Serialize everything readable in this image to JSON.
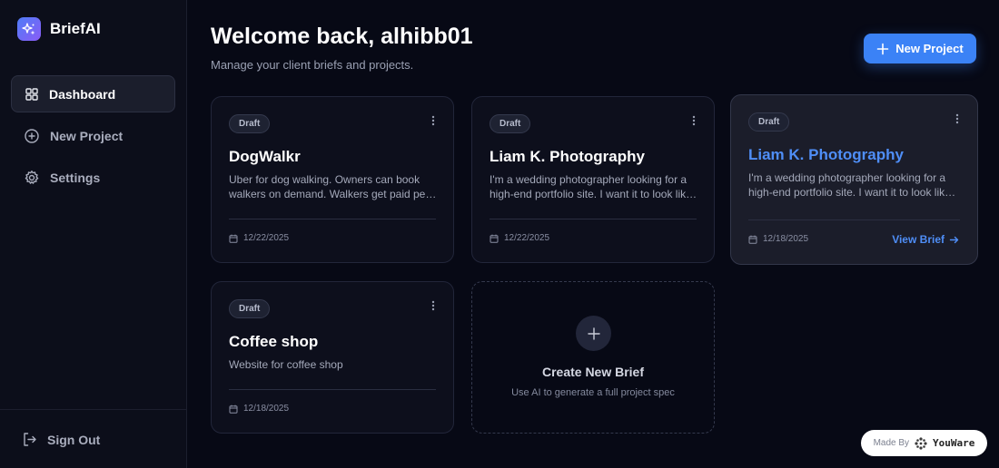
{
  "brand": {
    "name": "BriefAI"
  },
  "sidebar": {
    "items": [
      {
        "label": "Dashboard",
        "icon": "grid-icon",
        "active": true
      },
      {
        "label": "New Project",
        "icon": "plus-circle-icon",
        "active": false
      },
      {
        "label": "Settings",
        "icon": "gear-icon",
        "active": false
      }
    ],
    "sign_out": "Sign Out"
  },
  "header": {
    "title": "Welcome back, alhibb01",
    "subtitle": "Manage your client briefs and projects.",
    "new_project_label": "New Project"
  },
  "projects": [
    {
      "status": "Draft",
      "title": "DogWalkr",
      "description": "Uber for dog walking. Owners can book walkers on demand. Walkers get paid per walk.",
      "date": "12/22/2025"
    },
    {
      "status": "Draft",
      "title": "Liam K. Photography",
      "description": "I'm a wedding photographer looking for a high-end portfolio site. I want it to look like a magazine.",
      "date": "12/22/2025"
    },
    {
      "status": "Draft",
      "title": "Liam K. Photography",
      "description": "I'm a wedding photographer looking for a high-end portfolio site. I want it to look like a magazine.",
      "date": "12/18/2025",
      "action": "View Brief"
    },
    {
      "status": "Draft",
      "title": "Coffee shop",
      "description": "Website for coffee shop",
      "date": "12/18/2025"
    }
  ],
  "create_card": {
    "title": "Create New Brief",
    "subtitle": "Use AI to generate a full project spec"
  },
  "footer_badge": {
    "label": "Made By",
    "brand": "YouWare"
  },
  "colors": {
    "accent": "#3b82f6",
    "background": "#070915",
    "sidebar": "#0c0e1a"
  }
}
